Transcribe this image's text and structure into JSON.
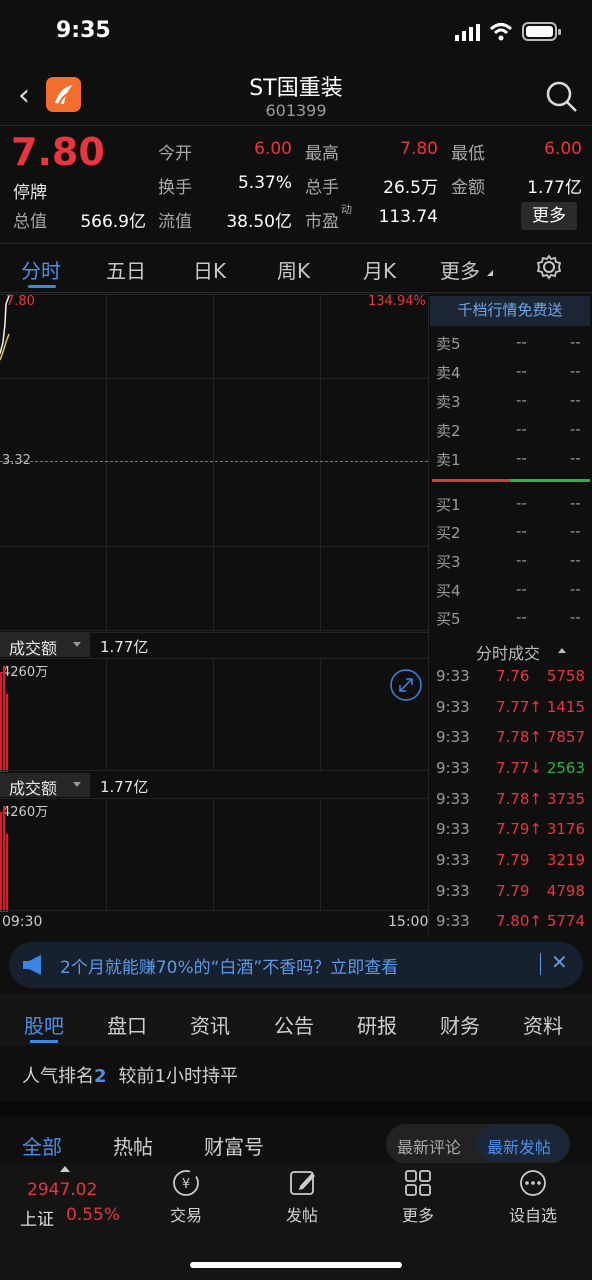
{
  "status_bar": {
    "time": "9:35"
  },
  "header": {
    "title": "ST国重装",
    "code": "601399"
  },
  "quote": {
    "price": "7.80",
    "status": "停牌",
    "fields": [
      {
        "label": "今开",
        "value": "6.00",
        "color": "#e8353f"
      },
      {
        "label": "最高",
        "value": "7.80",
        "color": "#e8353f"
      },
      {
        "label": "最低",
        "value": "6.00",
        "color": "#e8353f"
      },
      {
        "label": "换手",
        "value": "5.37%",
        "color": "#e6e6e6"
      },
      {
        "label": "总手",
        "value": "26.5万",
        "color": "#e6e6e6"
      },
      {
        "label": "金额",
        "value": "1.77亿",
        "color": "#e6e6e6"
      },
      {
        "label": "总值",
        "value": "566.9亿",
        "color": "#e6e6e6"
      },
      {
        "label": "流值",
        "value": "38.50亿",
        "color": "#e6e6e6"
      },
      {
        "label": "市盈",
        "label_sup": "动",
        "value": "113.74",
        "color": "#e6e6e6"
      }
    ],
    "more_button": "更多"
  },
  "chart_tabs": [
    "分时",
    "五日",
    "日K",
    "周K",
    "月K",
    "更多"
  ],
  "chart": {
    "price_top": "7.80",
    "pct_top": "134.94%",
    "price_mid": "3.32",
    "volume_label": "成交额",
    "volume_value": "1.77亿",
    "volume_max": "4260万",
    "time_start": "09:30",
    "time_end": "15:00"
  },
  "order_book": {
    "promo": "千档行情免费送",
    "asks": [
      {
        "label": "卖5",
        "price": "--",
        "vol": "--"
      },
      {
        "label": "卖4",
        "price": "--",
        "vol": "--"
      },
      {
        "label": "卖3",
        "price": "--",
        "vol": "--"
      },
      {
        "label": "卖2",
        "price": "--",
        "vol": "--"
      },
      {
        "label": "卖1",
        "price": "--",
        "vol": "--"
      }
    ],
    "bids": [
      {
        "label": "买1",
        "price": "--",
        "vol": "--"
      },
      {
        "label": "买2",
        "price": "--",
        "vol": "--"
      },
      {
        "label": "买3",
        "price": "--",
        "vol": "--"
      },
      {
        "label": "买4",
        "price": "--",
        "vol": "--"
      },
      {
        "label": "买5",
        "price": "--",
        "vol": "--"
      }
    ],
    "ticks_title": "分时成交",
    "ticks": [
      {
        "time": "9:33",
        "price": "7.76",
        "vol": "5758",
        "pcolor": "#e8353f",
        "vcolor": "#e8353f"
      },
      {
        "time": "9:33",
        "price": "7.77↑",
        "vol": "1415",
        "pcolor": "#e8353f",
        "vcolor": "#e8353f"
      },
      {
        "time": "9:33",
        "price": "7.78↑",
        "vol": "7857",
        "pcolor": "#e8353f",
        "vcolor": "#e8353f"
      },
      {
        "time": "9:33",
        "price": "7.77↓",
        "vol": "2563",
        "pcolor": "#e8353f",
        "vcolor": "#27b24a"
      },
      {
        "time": "9:33",
        "price": "7.78↑",
        "vol": "3735",
        "pcolor": "#e8353f",
        "vcolor": "#e8353f"
      },
      {
        "time": "9:33",
        "price": "7.79↑",
        "vol": "3176",
        "pcolor": "#e8353f",
        "vcolor": "#e8353f"
      },
      {
        "time": "9:33",
        "price": "7.79",
        "vol": "3219",
        "pcolor": "#e8353f",
        "vcolor": "#e8353f"
      },
      {
        "time": "9:33",
        "price": "7.79",
        "vol": "4798",
        "pcolor": "#e8353f",
        "vcolor": "#e8353f"
      },
      {
        "time": "9:33",
        "price": "7.80↑",
        "vol": "5774",
        "pcolor": "#e8353f",
        "vcolor": "#e8353f"
      }
    ]
  },
  "ad": {
    "text": "2个月就能赚70%的“白酒”不香吗？立即查看"
  },
  "sub_tabs": [
    "股吧",
    "盘口",
    "资讯",
    "公告",
    "研报",
    "财务",
    "资料"
  ],
  "rank": {
    "prefix": "人气排名",
    "num": "2",
    "suffix": "较前1小时持平"
  },
  "feed_tabs": [
    "全部",
    "热帖",
    "财富号"
  ],
  "sort": {
    "opt1": "最新评论",
    "opt2": "最新发帖"
  },
  "index": {
    "value": "2947.02",
    "name": "上证",
    "change": "0.55%"
  },
  "bottom_nav": [
    "交易",
    "发帖",
    "更多",
    "设自选"
  ],
  "colors": {
    "up": "#e8353f",
    "down": "#27b24a",
    "accent": "#3a86e6"
  }
}
